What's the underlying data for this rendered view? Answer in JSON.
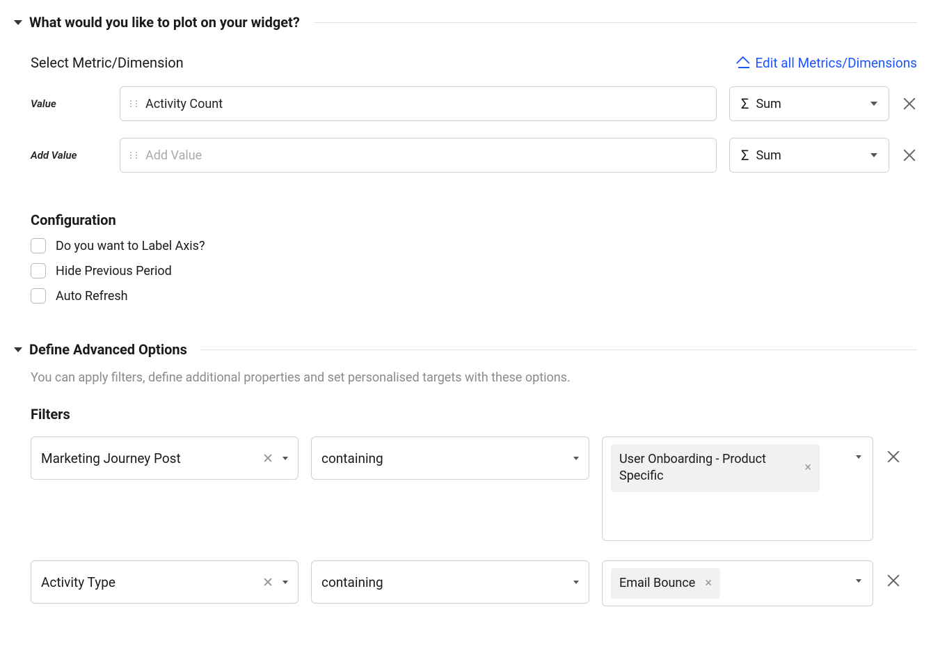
{
  "plot_section": {
    "title": "What would you like to plot on your widget?",
    "select_label": "Select Metric/Dimension",
    "edit_all": "Edit all Metrics/Dimensions",
    "rows": [
      {
        "label": "Value",
        "value": "Activity Count",
        "placeholder": "",
        "agg": "Sum"
      },
      {
        "label": "Add Value",
        "value": "",
        "placeholder": "Add Value",
        "agg": "Sum"
      }
    ]
  },
  "configuration": {
    "title": "Configuration",
    "options": [
      "Do you want to Label Axis?",
      "Hide Previous Period",
      "Auto Refresh"
    ]
  },
  "advanced": {
    "title": "Define Advanced Options",
    "desc": "You can apply filters, define additional properties and set personalised targets with these options.",
    "filters_title": "Filters",
    "filters": [
      {
        "field": "Marketing Journey Post",
        "op": "containing",
        "values": [
          "User Onboarding - Product Specific"
        ],
        "tall": true
      },
      {
        "field": "Activity Type",
        "op": "containing",
        "values": [
          "Email Bounce"
        ],
        "tall": false
      }
    ]
  }
}
